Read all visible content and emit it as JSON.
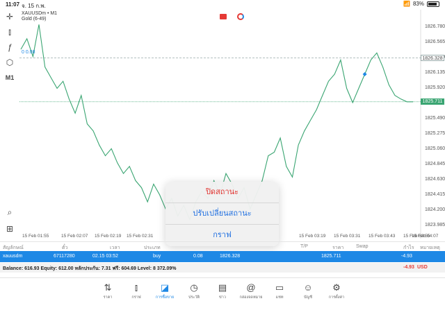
{
  "status_bar": {
    "time": "11:07",
    "date": "จ. 15 ก.พ.",
    "battery": "83%"
  },
  "chart_header": {
    "symbol": "XAUUSDm • M1",
    "indicator": "Gold (6-49)",
    "left_level": "0 0.08",
    "timeframe_tool": "M1"
  },
  "price_axis": {
    "ticks": [
      "1826.780",
      "1826.565",
      "1826.350",
      "1826.135",
      "1825.920",
      "1825.490",
      "1825.275",
      "1825.060",
      "1824.845",
      "1824.630",
      "1824.415",
      "1824.200",
      "1823.985"
    ],
    "marked_order_price": "1826.328",
    "current_price": "1825.711"
  },
  "time_axis": [
    "15 Feb 01:55",
    "15 Feb 02:07",
    "15 Feb 02:19",
    "15 Feb 02:31",
    "15 Feb 03:19",
    "15 Feb 03:31",
    "15 Feb 03:43",
    "15 Feb 03:55",
    "15 Feb 04:07"
  ],
  "popup": {
    "close_position": "ปิดสถานะ",
    "modify_position": "ปรับเปลี่ยนสถานะ",
    "chart": "กราฟ"
  },
  "table": {
    "headers": [
      "สัญลักษณ์",
      "ตั๋ว",
      "เวลา",
      "ประเภท",
      "T/P",
      "ราคา",
      "Swap",
      "กำไร",
      "หมายเหตุ"
    ],
    "row": {
      "symbol": "xauusdm",
      "ticket": "67117280",
      "time": "02.15 03:52",
      "type": "buy",
      "volume": "0.08",
      "open_price": "1826.328",
      "price": "1825.711",
      "profit": "-4.93"
    }
  },
  "balance_line": {
    "text": "Balance: 616.93 Equity: 612.00 หลักประกัน: 7.31 ฟรี: 604.69 Level: 8 372.09%",
    "profit": "-4.93",
    "currency": "USD"
  },
  "nav": [
    {
      "label": "ราคา",
      "icon": "quotes-arrows-icon"
    },
    {
      "label": "กราฟ",
      "icon": "candles-icon"
    },
    {
      "label": "การซื้อขาย",
      "icon": "trade-chart-icon"
    },
    {
      "label": "ประวัติ",
      "icon": "history-clock-icon"
    },
    {
      "label": "ข่าว",
      "icon": "news-icon"
    },
    {
      "label": "กล่องจดหมาย",
      "icon": "mail-at-icon"
    },
    {
      "label": "แชท",
      "icon": "chat-icon"
    },
    {
      "label": "บัญชี",
      "icon": "account-icon"
    },
    {
      "label": "การตั้งค่า",
      "icon": "settings-gear-icon"
    }
  ],
  "chart_data": {
    "type": "line",
    "x": [
      "01:50",
      "01:52",
      "01:54",
      "01:56",
      "01:58",
      "02:00",
      "02:02",
      "02:04",
      "02:06",
      "02:08",
      "02:10",
      "02:12",
      "02:14",
      "02:16",
      "02:18",
      "02:20",
      "02:22",
      "02:24",
      "02:26",
      "02:28",
      "02:30",
      "02:32",
      "02:34",
      "02:36",
      "02:38",
      "02:40",
      "02:42",
      "02:44",
      "02:46",
      "02:48",
      "02:50",
      "02:52",
      "02:54",
      "02:56",
      "02:58",
      "03:00",
      "03:02",
      "03:04",
      "03:06",
      "03:08",
      "03:10",
      "03:12",
      "03:14",
      "03:16",
      "03:18",
      "03:20",
      "03:22",
      "03:24",
      "03:26",
      "03:28",
      "03:30",
      "03:32",
      "03:34",
      "03:36",
      "03:38",
      "03:40",
      "03:42",
      "03:44",
      "03:46",
      "03:48",
      "03:50",
      "03:52",
      "03:54",
      "03:56",
      "03:58",
      "04:00"
    ],
    "y": [
      1826.45,
      1826.6,
      1826.35,
      1826.8,
      1826.2,
      1826.05,
      1825.9,
      1826.0,
      1825.75,
      1825.55,
      1825.8,
      1825.4,
      1825.3,
      1825.1,
      1824.95,
      1825.05,
      1824.85,
      1824.7,
      1824.8,
      1824.6,
      1824.5,
      1824.3,
      1824.55,
      1824.4,
      1824.2,
      1824.35,
      1824.1,
      1824.25,
      1824.05,
      1824.3,
      1824.45,
      1824.35,
      1824.6,
      1824.4,
      1824.7,
      1824.55,
      1824.35,
      1824.5,
      1824.2,
      1824.4,
      1824.6,
      1824.95,
      1825.0,
      1825.2,
      1824.8,
      1824.65,
      1825.1,
      1825.3,
      1825.45,
      1825.6,
      1825.8,
      1826.0,
      1826.1,
      1826.3,
      1825.9,
      1825.7,
      1825.9,
      1826.1,
      1826.3,
      1826.4,
      1826.2,
      1825.95,
      1825.8,
      1825.75,
      1825.71,
      1825.71
    ],
    "ylim": [
      1823.9,
      1826.95
    ],
    "grid": false,
    "lines": {
      "order_price": 1826.328,
      "current_price": 1825.711
    },
    "line_color": "#3aa572"
  }
}
